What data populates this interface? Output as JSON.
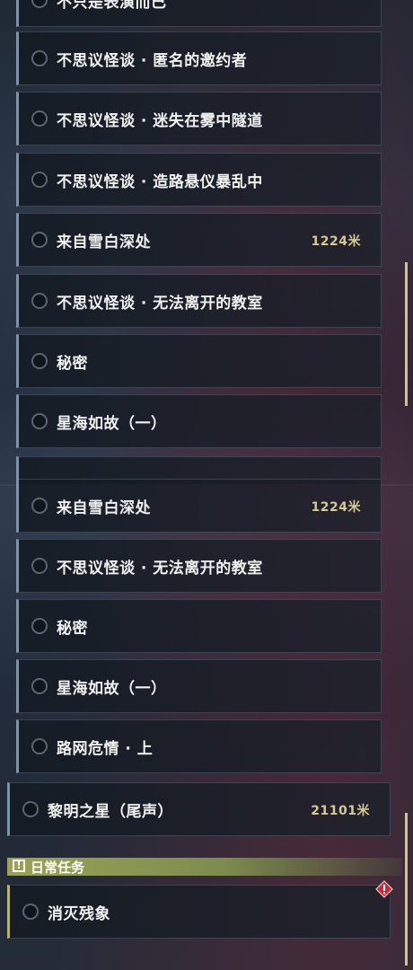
{
  "top_panel": {
    "items": [
      {
        "label": "不只是表演而已",
        "distance": ""
      },
      {
        "label": "不思议怪谈 · 匿名的邀约者",
        "distance": ""
      },
      {
        "label": "不思议怪谈 · 迷失在雾中隧道",
        "distance": ""
      },
      {
        "label": "不思议怪谈 · 造路悬仪暴乱中",
        "distance": ""
      },
      {
        "label": "来自雪白深处",
        "distance": "1224米"
      },
      {
        "label": "不思议怪谈 · 无法离开的教室",
        "distance": ""
      },
      {
        "label": "秘密",
        "distance": ""
      },
      {
        "label": "星海如故（一）",
        "distance": ""
      }
    ]
  },
  "bottom_panel": {
    "items": [
      {
        "label": "来自雪白深处",
        "distance": "1224米"
      },
      {
        "label": "不思议怪谈 · 无法离开的教室",
        "distance": ""
      },
      {
        "label": "秘密",
        "distance": ""
      },
      {
        "label": "星海如故（一）",
        "distance": ""
      },
      {
        "label": "路网危情 · 上",
        "distance": ""
      },
      {
        "label": "黎明之星（尾声）",
        "distance": "21101米"
      }
    ],
    "daily_section": {
      "title": "日常任务",
      "icon": "exclamation-box-icon",
      "items": [
        {
          "label": "消灭残象",
          "alert_icon": "red-diamond-alert-icon"
        }
      ]
    }
  },
  "colors": {
    "accent_scrollbar": "#cfc58a",
    "distance_text": "#d6c79a",
    "daily_header": "#9aa357",
    "alert": "#c0303c"
  }
}
